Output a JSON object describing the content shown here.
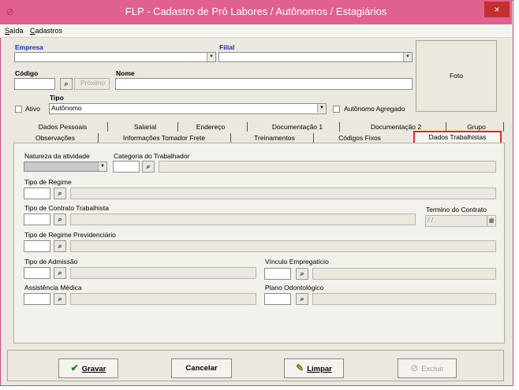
{
  "window": {
    "title": "FLP - Cadastro de Pró Labores / Autônomos / Estagiários",
    "close": "×"
  },
  "menu": {
    "saida": "Saída",
    "cadastros": "Cadastros"
  },
  "header": {
    "empresa_label": "Empresa",
    "empresa_value": "",
    "filial_label": "Filial",
    "filial_value": "",
    "codigo_label": "Código",
    "codigo_value": "",
    "proximo_label": "Próximo",
    "nome_label": "Nome",
    "nome_value": "",
    "tipo_label": "Tipo",
    "ativo_label": "Ativo",
    "ativo_checked": false,
    "tipo_value": "Autônomo",
    "autonomo_agregado_label": "Autônomo Agregado",
    "autonomo_agregado_checked": false,
    "foto_label": "Foto"
  },
  "tabs": {
    "row1": [
      "Dados Pessoais",
      "Salarial",
      "Endereço",
      "Documentação 1",
      "Documentação 2",
      "Grupo"
    ],
    "row2": [
      "Observações",
      "Informações Tomador Frete",
      "Treinamentos",
      "Códigos Fixos",
      "Dados Trabalhistas"
    ],
    "active": "Dados Trabalhistas"
  },
  "form": {
    "natureza_label": "Natureza da atividade",
    "categoria_label": "Categoria do Trabalhador",
    "tipo_regime_label": "Tipo de Regime",
    "tipo_contrato_label": "Tipo de Contrato Trabalhista",
    "termino_contrato_label": "Termino do Contrato",
    "termino_contrato_value": " / /",
    "regime_prev_label": "Tipo de Regime Previdenciário",
    "tipo_admissao_label": "Tipo de Admissão",
    "vinculo_label": "Vínculo Empregatício",
    "assistencia_label": "Assistência Médica",
    "plano_odonto_label": "Plano Odontológico"
  },
  "buttons": {
    "gravar": "Gravar",
    "cancelar": "Cancelar",
    "limpar": "Limpar",
    "excluir": "Excluir"
  },
  "icons": {
    "app": "flp-app-icon",
    "lookup": "binoculars-icon",
    "check": "check-icon",
    "broom": "broom-icon"
  }
}
